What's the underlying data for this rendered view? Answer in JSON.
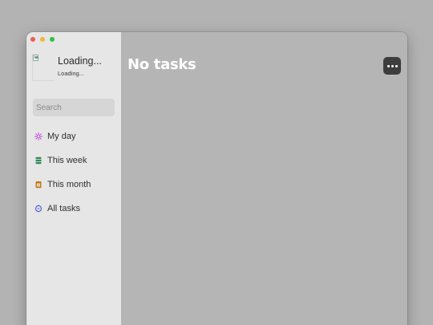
{
  "window_controls": {
    "close_color": "#ee5c52",
    "minimize_color": "#f2b735",
    "zoom_color": "#31c046"
  },
  "profile": {
    "name": "Loading...",
    "subtitle": "Loading..."
  },
  "search": {
    "placeholder": "Search",
    "value": ""
  },
  "sidebar": {
    "items": [
      {
        "label": "My day",
        "icon": "sun-icon",
        "color": "#c23ad6"
      },
      {
        "label": "This week",
        "icon": "week-stack-icon",
        "color": "#2e8b57"
      },
      {
        "label": "This month",
        "icon": "calendar-icon",
        "color": "#c27a1a"
      },
      {
        "label": "All tasks",
        "icon": "cycle-icon",
        "color": "#4a55d6"
      }
    ]
  },
  "main": {
    "title": "No tasks",
    "more_button_icon": "more-dots-icon"
  }
}
